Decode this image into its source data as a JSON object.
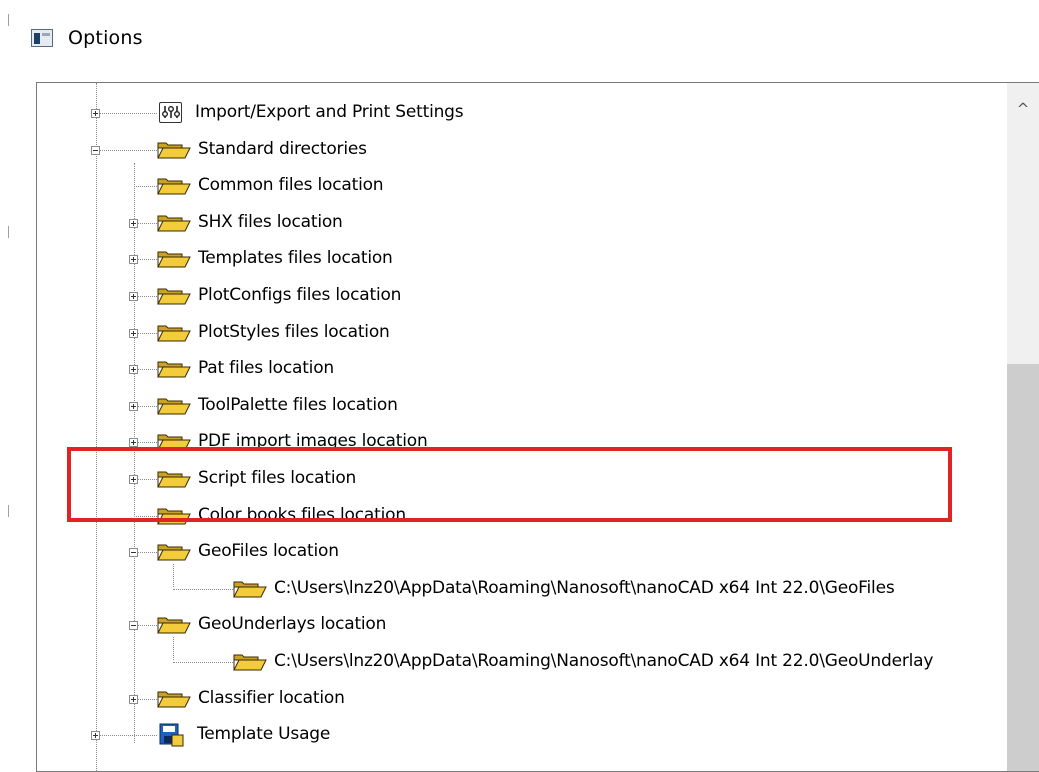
{
  "window": {
    "title": "Options",
    "title_icon": "window-icon"
  },
  "tree": {
    "nodes": [
      {
        "label": "Import/Export and Print Settings",
        "icon": "settings-icon",
        "expander": "plus"
      },
      {
        "label": "Standard directories",
        "icon": "folder-open-icon",
        "expander": "minus"
      },
      {
        "label": "Common files location",
        "icon": "folder-open-icon",
        "expander": "none"
      },
      {
        "label": "SHX files location",
        "icon": "folder-open-icon",
        "expander": "plus"
      },
      {
        "label": "Templates files location",
        "icon": "folder-open-icon",
        "expander": "plus"
      },
      {
        "label": "PlotConfigs files location",
        "icon": "folder-open-icon",
        "expander": "plus"
      },
      {
        "label": "PlotStyles files location",
        "icon": "folder-open-icon",
        "expander": "plus"
      },
      {
        "label": "Pat files location",
        "icon": "folder-open-icon",
        "expander": "plus"
      },
      {
        "label": "ToolPalette files location",
        "icon": "folder-open-icon",
        "expander": "plus"
      },
      {
        "label": "PDF import images location",
        "icon": "folder-open-icon",
        "expander": "plus"
      },
      {
        "label": "Script files location",
        "icon": "folder-open-icon",
        "expander": "plus"
      },
      {
        "label": "Color books files location",
        "icon": "folder-open-icon",
        "expander": "none"
      },
      {
        "label": "GeoFiles location",
        "icon": "folder-open-icon",
        "expander": "minus"
      },
      {
        "label": "C:\\Users\\lnz20\\AppData\\Roaming\\Nanosoft\\nanoCAD x64 Int 22.0\\GeoFiles",
        "icon": "folder-open-icon",
        "expander": "none"
      },
      {
        "label": "GeoUnderlays location",
        "icon": "folder-open-icon",
        "expander": "minus"
      },
      {
        "label": "C:\\Users\\lnz20\\AppData\\Roaming\\Nanosoft\\nanoCAD x64 Int 22.0\\GeoUnderlay",
        "icon": "folder-open-icon",
        "expander": "none"
      },
      {
        "label": "Classifier location",
        "icon": "folder-open-icon",
        "expander": "plus"
      },
      {
        "label": "Template Usage",
        "icon": "template-usage-icon",
        "expander": "plus"
      }
    ]
  },
  "scrollbar": {
    "up_arrow": "^",
    "up_icon": "chevron-up-icon"
  },
  "highlight": {
    "color": "#e02424",
    "target": "GeoFiles location"
  }
}
